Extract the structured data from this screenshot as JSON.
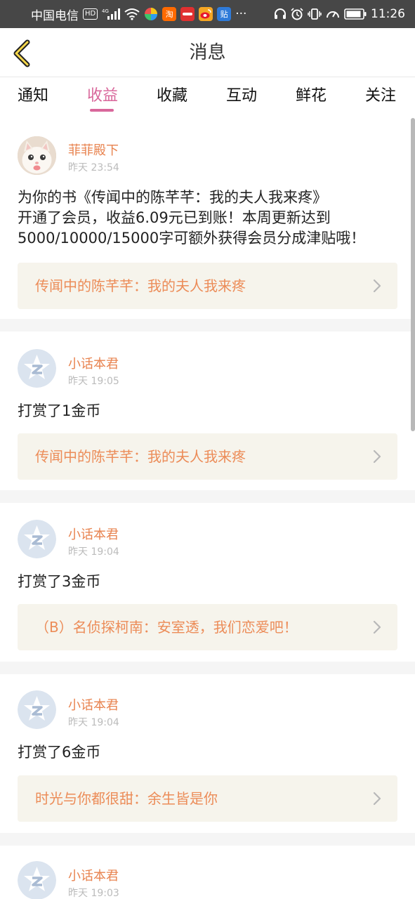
{
  "status_bar": {
    "carrier": "中国电信",
    "hd": "HD",
    "network": "4G",
    "apps": [
      {
        "icon": "taobao-app-icon",
        "label": "淘",
        "color": "#ff6a00"
      },
      {
        "icon": "red-app-icon",
        "label": "",
        "color": "#e03030"
      },
      {
        "icon": "weibo-app-icon",
        "label": "",
        "color": "#f5a623"
      },
      {
        "icon": "tieba-app-icon",
        "label": "贴",
        "color": "#2f7bd9"
      }
    ],
    "more": "···",
    "time": "11:26"
  },
  "header": {
    "title": "消息"
  },
  "tabs": [
    {
      "label": "通知",
      "active": false
    },
    {
      "label": "收益",
      "active": true
    },
    {
      "label": "收藏",
      "active": false
    },
    {
      "label": "互动",
      "active": false
    },
    {
      "label": "鲜花",
      "active": false
    },
    {
      "label": "关注",
      "active": false
    }
  ],
  "messages": [
    {
      "name": "菲菲殿下",
      "time": "昨天 23:54",
      "avatar": "cat-photo-avatar",
      "text_lines": [
        "为你的书《传闻中的陈芊芊：我的夫人我来疼》",
        "开通了会员，收益6.09元已到账！本周更新达到",
        "5000/10000/15000字可额外获得会员分成津贴哦！"
      ],
      "book": "传闻中的陈芊芊：我的夫人我来疼"
    },
    {
      "name": "小话本君",
      "time": "昨天 19:05",
      "avatar": "default-z-avatar",
      "text_lines": [
        "打赏了1金币"
      ],
      "book": "传闻中的陈芊芊：我的夫人我来疼"
    },
    {
      "name": "小话本君",
      "time": "昨天 19:04",
      "avatar": "default-z-avatar",
      "text_lines": [
        "打赏了3金币"
      ],
      "book": "（B）名侦探柯南：安室透，我们恋爱吧！"
    },
    {
      "name": "小话本君",
      "time": "昨天 19:04",
      "avatar": "default-z-avatar",
      "text_lines": [
        "打赏了6金币"
      ],
      "book": "时光与你都很甜：余生皆是你"
    },
    {
      "name": "小话本君",
      "time": "昨天 19:03",
      "avatar": "default-z-avatar",
      "text_lines": [],
      "book": ""
    }
  ]
}
